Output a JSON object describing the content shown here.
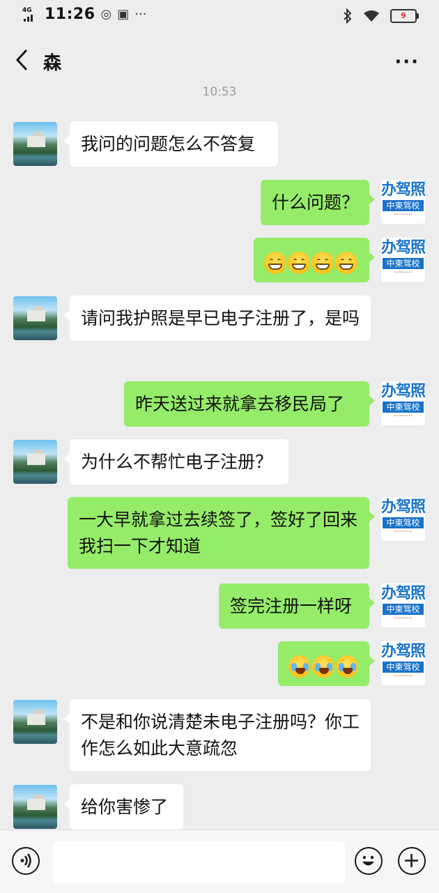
{
  "status_bar": {
    "network": "4G",
    "time": "11:26",
    "battery": "9"
  },
  "header": {
    "title": "森"
  },
  "timestamp": "10:53",
  "contact_avatar": {
    "icon": "landscape-photo-avatar"
  },
  "my_avatar": {
    "big_text": "办驾照",
    "band_text": "中柬驾校"
  },
  "messages": [
    {
      "side": "left",
      "text": "我问的问题怎么不答复"
    },
    {
      "side": "right",
      "text": "什么问题？"
    },
    {
      "side": "right",
      "emoji": "grinning-face",
      "count": 4
    },
    {
      "side": "left",
      "text": "请问我护照是早已电子注册了，是吗"
    },
    {
      "side": "right",
      "text": "昨天送过来就拿去移民局了"
    },
    {
      "side": "left",
      "text": "为什么不帮忙电子注册？"
    },
    {
      "side": "right",
      "text": "一大早就拿过去续签了，签好了回来我扫一下才知道"
    },
    {
      "side": "right",
      "text": "签完注册一样呀"
    },
    {
      "side": "right",
      "emoji": "loudly-crying-face",
      "count": 3
    },
    {
      "side": "left",
      "text": "不是和你说清楚未电子注册吗？你工作怎么如此大意疏忽"
    },
    {
      "side": "left",
      "text": "给你害惨了"
    }
  ],
  "input_bar": {
    "voice_icon": "voice-icon",
    "emoji_icon": "emoji-icon",
    "plus_icon": "plus-icon",
    "placeholder": ""
  }
}
